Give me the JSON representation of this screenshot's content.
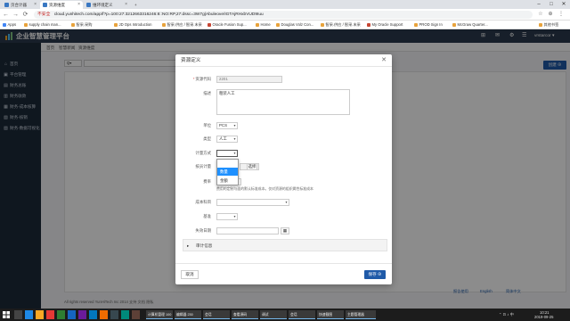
{
  "browser": {
    "tabs": [
      {
        "label": "页合计器",
        "color": "#3a78c2"
      },
      {
        "label": "资源维度",
        "color": "#3a78c2"
      },
      {
        "label": "维环境定义",
        "color": "#3a78c2"
      }
    ],
    "new_tab": "+",
    "controls": {
      "minimize": "–",
      "maximize": "□",
      "close": "✕"
    },
    "nav": {
      "back": "←",
      "forward": "→",
      "reload": "⟳"
    },
    "security_label": "不安全",
    "url": "cloud.yunhitech.com/app/f?p=100:27:3212663316246:8::NO:RP,27:dssc=3W7g|Abuleove/IGTAjRHxbVUD9Iuu",
    "extensions": [
      "☆",
      "⊕",
      "⋮"
    ],
    "bookmarks": [
      "Apps",
      "supply chain man...",
      "智采.采购",
      "JD Ops Introduction",
      "智采.供应 / 智采.末采",
      "Oracle Fusion Sup...",
      "Home",
      "Douglas Volz Con...",
      "智采.供应 / 智采.末采",
      "My Oracle Support",
      "PROD Sign In",
      "McGraw Quarter...",
      "其他书签"
    ]
  },
  "app": {
    "title": "企业智慧管理平台",
    "header_icons": [
      "⊞",
      "✉",
      "⚙",
      "☰"
    ],
    "user": "vrstarcor ▾",
    "sidebar": [
      {
        "icon": "⌂",
        "label": "首页"
      },
      {
        "icon": "▣",
        "label": "平台管理"
      },
      {
        "icon": "▤",
        "label": "财务总账"
      },
      {
        "icon": "▥",
        "label": "财务收款"
      },
      {
        "icon": "▦",
        "label": "财务-成本核算"
      },
      {
        "icon": "▧",
        "label": "财务-核销"
      },
      {
        "icon": "▨",
        "label": "财务-数据可视化"
      }
    ],
    "content_tabs": [
      "首页",
      "智慧新闻",
      "资源维度"
    ],
    "search": {
      "select_value": "Q▾",
      "go_label": "前往",
      "actions_label": "操作 ▾"
    },
    "create_button": "创建 ⊕",
    "footer": {
      "copyright": "All rights reserved YunHiTech Inc 2014  支持   文档   隐私",
      "links": [
        "报告使用",
        "English",
        "简体中文"
      ]
    }
  },
  "modal": {
    "title": "资源定义",
    "close": "✕",
    "fields": {
      "resource_code": {
        "label": "资源代码",
        "value": "2201"
      },
      "description": {
        "label": "描述",
        "value": "粗装人工"
      },
      "unit": {
        "label": "单位",
        "value": "PCS"
      },
      "type": {
        "label": "类型",
        "value": "人工"
      },
      "calc_method": {
        "label": "计量方式",
        "value": ""
      },
      "rate_calc": {
        "label": "按员计量",
        "value": "",
        "button": "选择"
      },
      "rate": {
        "label": "费率",
        "value": "",
        "help": "费用的定制与面的默认标准成本。仅对资源的组织属性标准成本"
      },
      "cost_subject": {
        "label": "成本科目",
        "value": ""
      },
      "basis": {
        "label": "基准",
        "value": ""
      },
      "inactive_date": {
        "label": "失效日期",
        "value": "",
        "calendar": "▦"
      }
    },
    "dropdown_options": [
      {
        "label": "数量",
        "highlighted": true
      },
      {
        "label": "金额",
        "highlighted": false
      }
    ],
    "section_title": "审计信息",
    "section_chevron": "▸",
    "cancel_label": "取消",
    "save_label": "保存 ⊕"
  },
  "taskbar": {
    "apps": [
      {
        "label": "计算机管理 100"
      },
      {
        "label": "编辑器 230"
      },
      {
        "label": "会话"
      },
      {
        "label": "查看源码"
      },
      {
        "label": "调试"
      },
      {
        "label": "会话"
      },
      {
        "label": "快速截图"
      },
      {
        "label": "主题管理器"
      }
    ],
    "tray_time": "10:21",
    "tray_date": "2019-09-25",
    "tray_icons": "⌃ ⊡ ♪ 中"
  }
}
